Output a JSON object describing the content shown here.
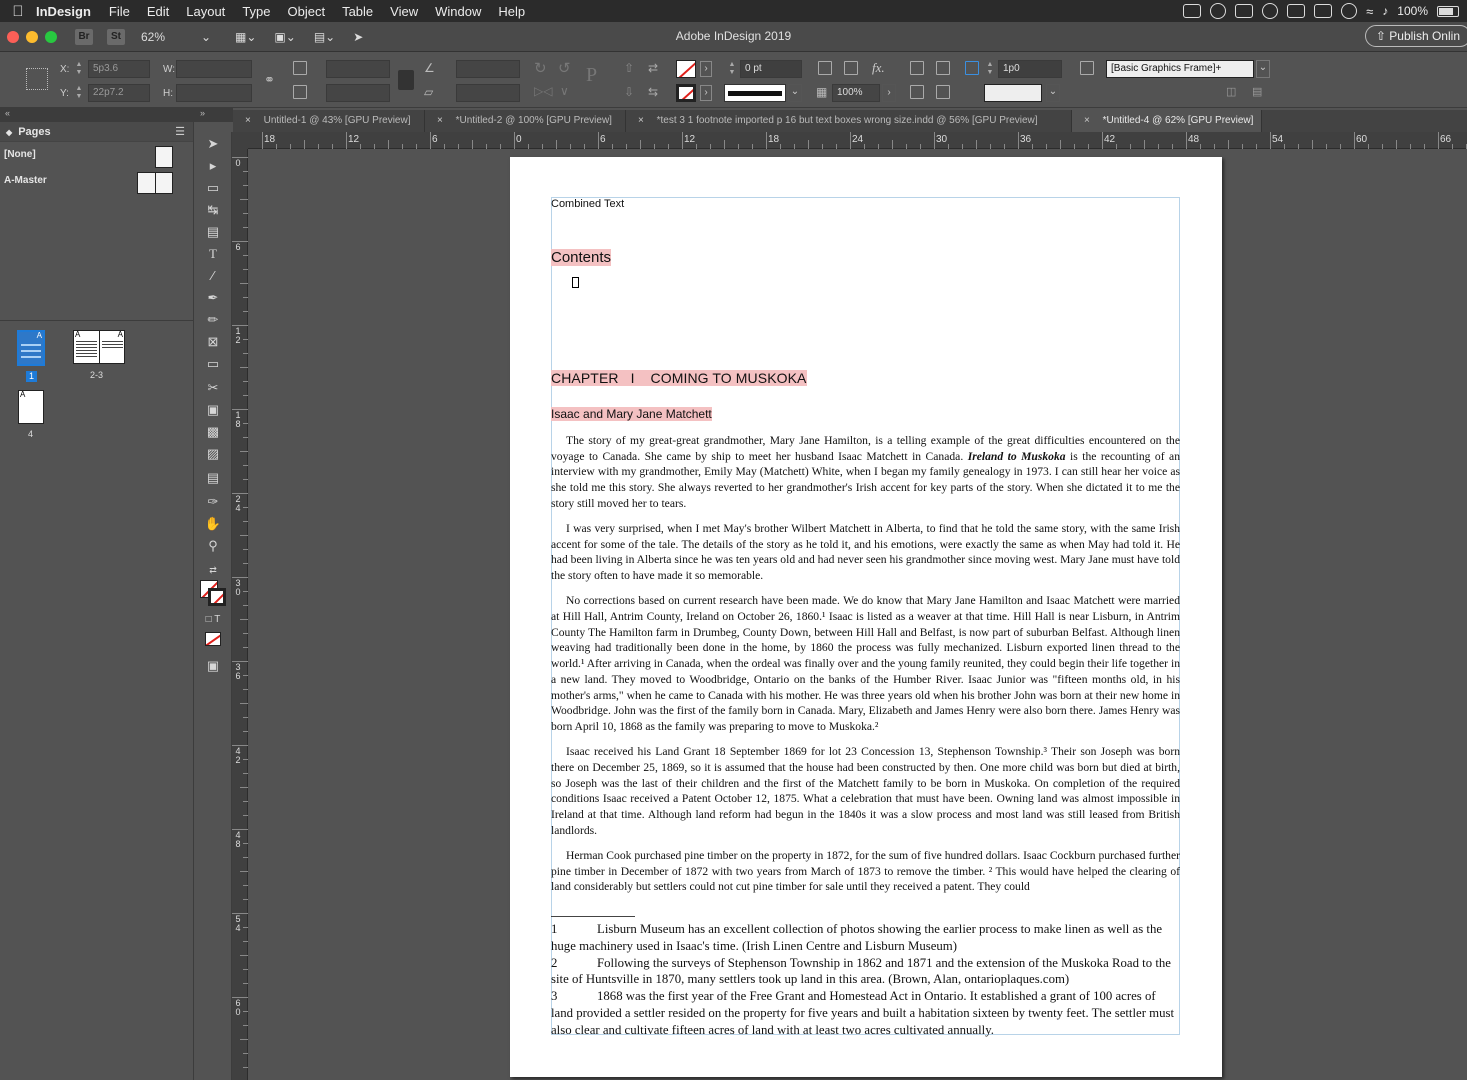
{
  "menubar": {
    "app_name": "InDesign",
    "items": [
      "File",
      "Edit",
      "Layout",
      "Type",
      "Object",
      "Table",
      "View",
      "Window",
      "Help"
    ],
    "battery": "100%"
  },
  "appbar": {
    "bridge": "Br",
    "stock": "St",
    "zoom": "62%",
    "title": "Adobe InDesign 2019",
    "publish": "Publish Onlin"
  },
  "control": {
    "x_label": "X:",
    "x_value": "5p3.6",
    "y_label": "Y:",
    "y_value": "22p7.2",
    "w_label": "W:",
    "h_label": "H:",
    "stroke_weight": "0 pt",
    "scale": "100%",
    "gap": "1p0",
    "object_style": "[Basic Graphics Frame]+"
  },
  "tabs": [
    {
      "label": "Untitled-1 @ 43% [GPU Preview]",
      "active": false
    },
    {
      "label": "*Untitled-2 @ 100% [GPU Preview]",
      "active": false
    },
    {
      "label": "*test 3 1 footnote imported p 16 but text boxes wrong size.indd @ 56% [GPU Preview]",
      "active": false
    },
    {
      "label": "*Untitled-4 @ 62% [GPU Preview]",
      "active": true
    }
  ],
  "pages_panel": {
    "title": "Pages",
    "masters": [
      "[None]",
      "A-Master"
    ],
    "page_1": "1",
    "spread_2_3": "2-3",
    "page_4": "4",
    "master_letter": "A"
  },
  "hruler": [
    "18",
    "12",
    "6",
    "0",
    "6",
    "12",
    "18",
    "24",
    "30",
    "36",
    "42",
    "48",
    "54",
    "60",
    "66"
  ],
  "vruler": [
    "0",
    "6",
    "12",
    "18",
    "24",
    "30",
    "36",
    "42",
    "48",
    "54",
    "60"
  ],
  "document": {
    "style_tag": "Combined Text",
    "contents_heading": "Contents",
    "chapter_heading": "CHAPTER   I    COMING TO MUSKOKA",
    "subheading": "Isaac and Mary Jane Matchett",
    "p1_a": "The story of my great-great grandmother, Mary Jane Hamilton, is a telling example of the great difficulties encountered on the voyage to Canada. She came by ship to meet her husband Isaac Matchett in Canada. ",
    "p1_em": "Ireland to Muskoka",
    "p1_b": " is the recounting of an interview with my grandmother, Emily May (Matchett) White, when I began my family genealogy in 1973. I can still hear her voice as she  told me this story. She always reverted to her grandmother's Irish accent for key parts of the story. When she dictated it to me the story still moved her to tears.",
    "p2": "I was very surprised, when I met May's brother Wilbert Matchett in Alberta, to find that he told the same story, with the same Irish accent for some of the tale. The details of the story as he told it, and his emotions, were exactly the same as when May had told it. He had been living in Alberta since he was ten years old and had never seen his grandmother since moving west. Mary Jane must have told the story often to have made it so memorable.",
    "p3": "No corrections based on current research have been made. We do know that Mary Jane Hamilton and Isaac Matchett were married at Hill Hall, Antrim County, Ireland on October 26, 1860.¹ Isaac is listed as a weaver at that time. Hill Hall is near Lisburn, in Antrim County  The Hamilton farm in Drumbeg, County Down, between Hill Hall and Belfast,  is now part of suburban Belfast.  Although linen weaving had traditionally been done in the home, by 1860 the process was fully mechanized. Lisburn exported linen thread to the world.¹ After arriving in Canada, when  the ordeal was finally over and the young family reunited, they could begin their life together in a new land. They moved to Woodbridge, Ontario on the banks of the Humber River. Isaac Junior was \"fifteen months old, in his mother's arms,\" when he came to Canada with his mother. He was three years old when his brother John was born at their new home in Woodbridge. John was the first of the family born in Canada. Mary, Elizabeth and James Henry were also born there. James Henry was born April 10, 1868 as the family was preparing to move to Muskoka.²",
    "p4": "Isaac received his Land Grant 18 September 1869 for lot 23 Concession 13, Stephenson Township.³ Their son Joseph was born there on December 25, 1869, so it is  assumed that the house had been constructed by then. One more child was born but died at birth, so Joseph was the last of their children and the first of the Matchett family to be born in Muskoka. On completion of the required  conditions Isaac received a Patent October 12, 1875.   What a celebration that must have been. Owning land was almost impossible in Ireland at that time. Although land reform had begun in the 1840s it was a slow process and most land was still leased from British landlords.",
    "p5": "Herman Cook purchased pine timber on the property in 1872, for the sum of five hundred dollars. Isaac Cockburn purchased further pine timber in December of 1872 with two years from March of 1873 to remove the timber. ² This would have helped the clearing of land considerably but settlers could not cut pine timber for sale until they received a patent. They could",
    "footnotes": [
      {
        "num": "1",
        "text": "Lisburn Museum has an excellent collection of photos showing the earlier process to make linen as well as the huge machinery used in Isaac's time. (Irish Linen Centre and Lisburn Museum)"
      },
      {
        "num": "2",
        "text": "Following the surveys of Stephenson Township in 1862 and 1871 and the extension of the Muskoka Road to the site of Huntsville in 1870, many settlers took up land in this area. (Brown, Alan, ontarioplaques.com)"
      },
      {
        "num": "3",
        "text": "1868 was the first year of the Free Grant and Homestead Act in Ontario. It established a grant of 100 acres of land provided a settler resided on the property for five years and built a habitation sixteen by twenty feet. The settler must also clear and  cultivate  fifteen acres of land with at least two acres cultivated annually."
      }
    ]
  },
  "colors": {
    "highlight": "#f4c1c2",
    "frame_edge": "#b8d3e8",
    "selected_page": "#1e7bd8"
  }
}
